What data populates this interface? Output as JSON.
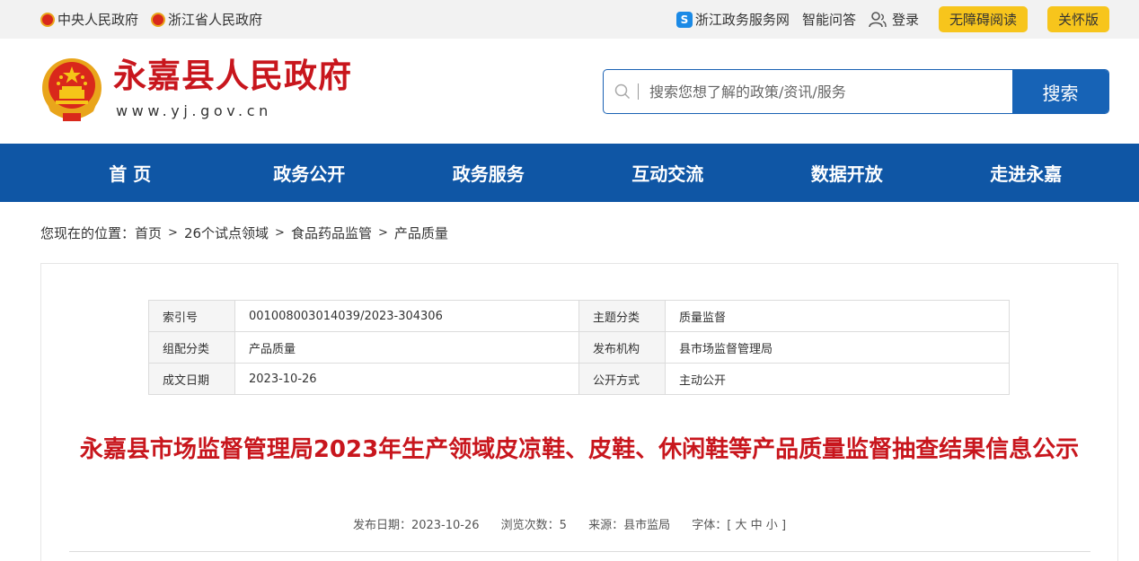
{
  "topbar": {
    "left_links": [
      "中央人民政府",
      "浙江省人民政府"
    ],
    "service_link": "浙江政务服务网",
    "qa_link": "智能问答",
    "login": "登录",
    "accessibility_btn": "无障碍阅读",
    "elder_btn": "关怀版"
  },
  "header": {
    "site_name": "永嘉县人民政府",
    "site_url": "www.yj.gov.cn",
    "search_placeholder": "搜索您想了解的政策/资讯/服务",
    "search_button": "搜索"
  },
  "nav": {
    "items": [
      "首 页",
      "政务公开",
      "政务服务",
      "互动交流",
      "数据开放",
      "走进永嘉"
    ]
  },
  "breadcrumb": {
    "label": "您现在的位置：",
    "items": [
      "首页",
      "26个试点领域",
      "食品药品监管",
      "产品质量"
    ],
    "separator": ">"
  },
  "meta": {
    "rows": [
      {
        "l1": "索引号",
        "v1": "001008003014039/2023-304306",
        "l2": "主题分类",
        "v2": "质量监督"
      },
      {
        "l1": "组配分类",
        "v1": "产品质量",
        "l2": "发布机构",
        "v2": "县市场监督管理局"
      },
      {
        "l1": "成文日期",
        "v1": "2023-10-26",
        "l2": "公开方式",
        "v2": "主动公开"
      }
    ]
  },
  "article": {
    "title": "永嘉县市场监督管理局2023年生产领域皮凉鞋、皮鞋、休闲鞋等产品质量监督抽查结果信息公示",
    "publish_date": "发布日期：2023-10-26",
    "views": "浏览次数：5",
    "source": "来源：县市监局",
    "font_label": "字体：[",
    "font_large": "大",
    "font_medium": "中",
    "font_small": "小",
    "font_close": "]"
  },
  "colors": {
    "brand_red": "#c8161d",
    "nav_blue": "#0f56a5",
    "button_yellow": "#f7c51c"
  }
}
